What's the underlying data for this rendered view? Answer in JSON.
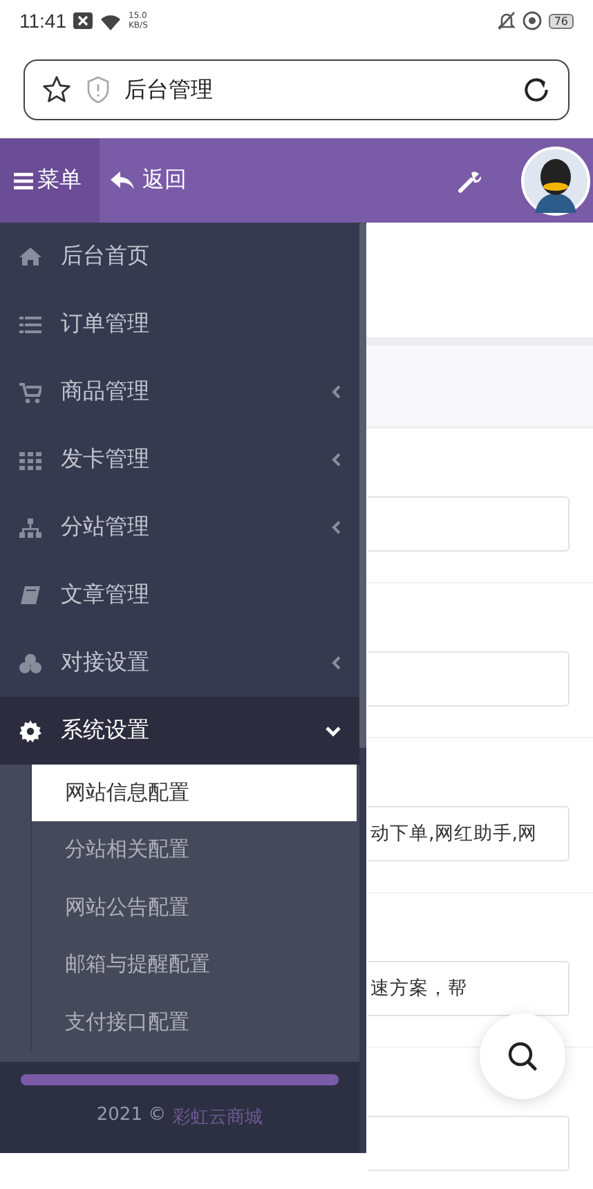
{
  "status_bar": {
    "time": "11:41",
    "net_speed": "15.0",
    "net_unit": "KB/S",
    "battery": "76"
  },
  "browser": {
    "title": "后台管理"
  },
  "header": {
    "menu_label": "菜单",
    "back_label": "返回"
  },
  "sidebar": {
    "items": [
      {
        "label": "后台首页",
        "has_submenu": false,
        "expanded": false
      },
      {
        "label": "订单管理",
        "has_submenu": false,
        "expanded": false
      },
      {
        "label": "商品管理",
        "has_submenu": true,
        "expanded": false
      },
      {
        "label": "发卡管理",
        "has_submenu": true,
        "expanded": false
      },
      {
        "label": "分站管理",
        "has_submenu": true,
        "expanded": false
      },
      {
        "label": "文章管理",
        "has_submenu": false,
        "expanded": false
      },
      {
        "label": "对接设置",
        "has_submenu": true,
        "expanded": false
      },
      {
        "label": "系统设置",
        "has_submenu": true,
        "expanded": true,
        "children": [
          {
            "label": "网站信息配置",
            "selected": true
          },
          {
            "label": "分站相关配置",
            "selected": false
          },
          {
            "label": "网站公告配置",
            "selected": false
          },
          {
            "label": "邮箱与提醒配置",
            "selected": false
          },
          {
            "label": "支付接口配置",
            "selected": false
          }
        ]
      }
    ],
    "footer": {
      "year": "2021 ©",
      "brand": "彩虹云商城"
    }
  },
  "form": {
    "fields": [
      {
        "kind": "input"
      },
      {
        "kind": "input"
      },
      {
        "kind": "input",
        "value": "动下单,网红助手,网"
      },
      {
        "kind": "input",
        "value": "速方案，帮"
      },
      {
        "kind": "input"
      }
    ]
  }
}
